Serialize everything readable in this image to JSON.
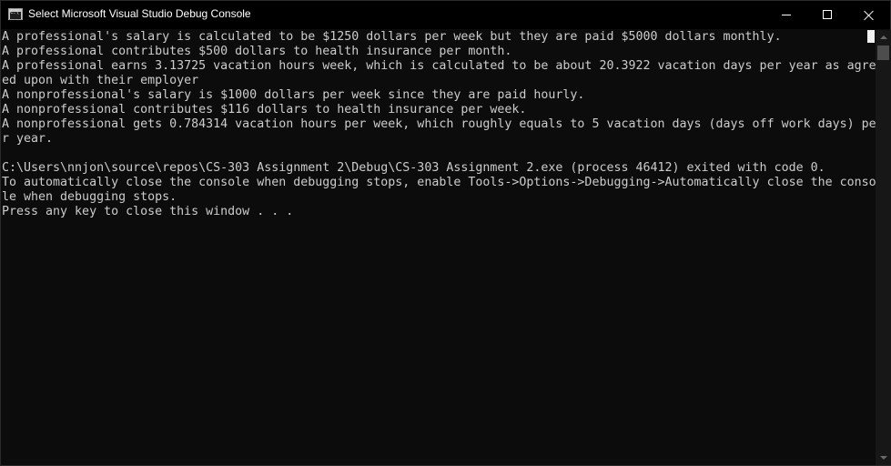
{
  "window": {
    "title": "Select Microsoft Visual Studio Debug Console",
    "icon": "console-app-icon",
    "icon_glyph": "C:\\"
  },
  "controls": {
    "minimize_icon": "minimize-icon",
    "maximize_icon": "maximize-icon",
    "close_icon": "close-icon"
  },
  "console": {
    "lines": [
      "A professional's salary is calculated to be $1250 dollars per week but they are paid $5000 dollars monthly.",
      "A professional contributes $500 dollars to health insurance per month.",
      "A professional earns 3.13725 vacation hours week, which is calculated to be about 20.3922 vacation days per year as agre",
      "ed upon with their employer",
      "A nonprofessional's salary is $1000 dollars per week since they are paid hourly.",
      "A nonprofessional contributes $116 dollars to health insurance per week.",
      "A nonprofessional gets 0.784314 vacation hours per week, which roughly equals to 5 vacation days (days off work days) pe",
      "r year.",
      "",
      "C:\\Users\\nnjon\\source\\repos\\CS-303 Assignment 2\\Debug\\CS-303 Assignment 2.exe (process 46412) exited with code 0.",
      "To automatically close the console when debugging stops, enable Tools->Options->Debugging->Automatically close the conso",
      "le when debugging stops.",
      "Press any key to close this window . . ."
    ]
  },
  "colors": {
    "background": "#0c0c0c",
    "text": "#cccccc",
    "titlebar": "#000000"
  }
}
